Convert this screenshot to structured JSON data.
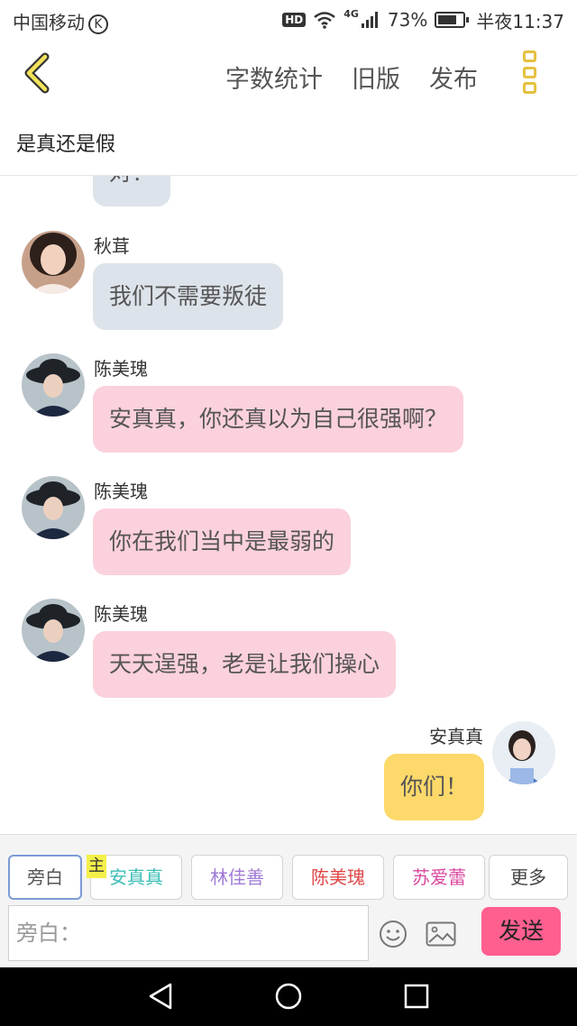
{
  "status_bar": {
    "carrier": "中国移动",
    "carrier_badge": "K",
    "hd": "HD",
    "network": "4G",
    "battery": "73%",
    "time": "半夜11:37"
  },
  "header": {
    "actions": [
      "字数统计",
      "旧版",
      "发布"
    ]
  },
  "story_title": "是真还是假",
  "messages": {
    "partial_text": "对！",
    "m1": {
      "name": "秋茸",
      "text": "我们不需要叛徒"
    },
    "m2": {
      "name": "陈美瑰",
      "text": "安真真，你还真以为自己很强啊？"
    },
    "m3": {
      "name": "陈美瑰",
      "text": "你在我们当中是最弱的"
    },
    "m4": {
      "name": "陈美瑰",
      "text": "天天逞强，老是让我们操心"
    },
    "m5": {
      "name": "安真真",
      "text": "你们！"
    }
  },
  "roles": {
    "narrator": "旁白",
    "main_badge": "主",
    "r1": "安真真",
    "r2": "林佳善",
    "r3": "陈美瑰",
    "r4": "苏爱蕾",
    "more": "更多"
  },
  "role_colors": {
    "r1": "#3bbfb6",
    "r2": "#a07ad6",
    "r3": "#e04848",
    "r4": "#d9489e"
  },
  "input": {
    "placeholder": "旁白：",
    "send_label": "发送"
  }
}
